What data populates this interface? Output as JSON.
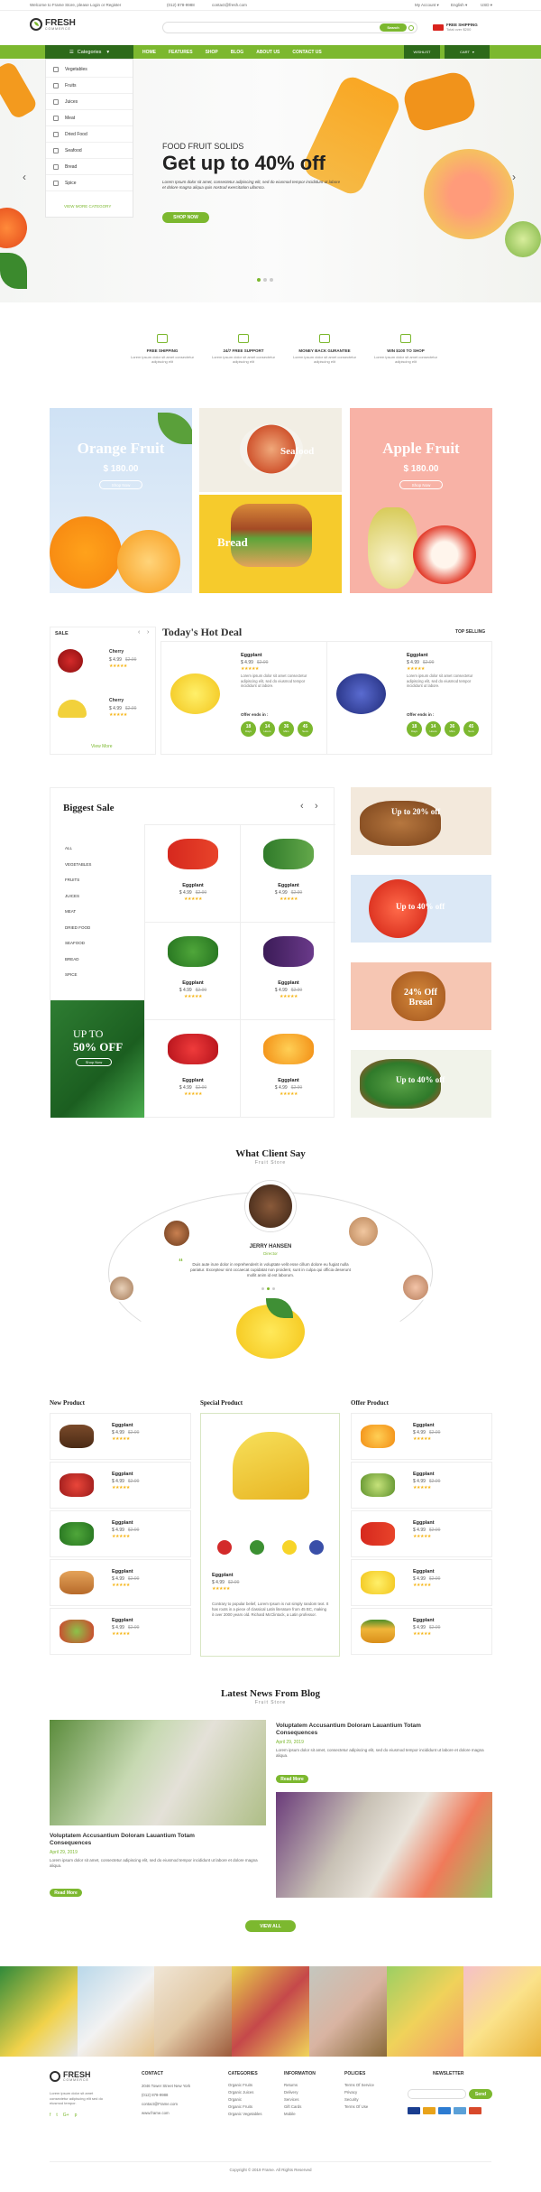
{
  "topbar": {
    "welcome": "Welcome to Frame Store, please Login or Register",
    "phone": "(012) 878-9988",
    "email": "contact@fresh.com",
    "account": "My Account ▾",
    "language": "English ▾",
    "currency": "USD ▾"
  },
  "header": {
    "logo_main": "FRESH",
    "logo_sub": "COMMERCE",
    "search_placeholder": "",
    "search_button": "Search",
    "shipping_title": "FREE SHIPPING",
    "shipping_sub": "Total over $200"
  },
  "nav": {
    "categories_label": "Categories",
    "items": [
      "HOME",
      "FEATURES",
      "SHOP",
      "BLOG",
      "ABOUT US",
      "CONTACT US"
    ],
    "wishlist": "WISHLIST",
    "cart": "CART"
  },
  "categories": [
    "Vegetables",
    "Fruits",
    "Juices",
    "Meat",
    "Dried Food",
    "Seafood",
    "Bread",
    "Spice"
  ],
  "categories_more": "VIEW MORE CATEGORY",
  "hero": {
    "kicker": "FOOD FRUIT SOLIDS",
    "title": "Get up to 40% off",
    "desc": "Lorem Ipsum dolor sit amet, consectetur adipiscing elit, sed do eiusmod tempor incididunt ut labore et dolore magna aliqua quis nostrud exercitation ullamco.",
    "button": "SHOP NOW"
  },
  "features": [
    {
      "title": "FREE SHIPPING",
      "desc": "Lorem ipsum dolor sit amet consectetur adipiscing elit"
    },
    {
      "title": "24/7 FREE SUPPORT",
      "desc": "Lorem ipsum dolor sit amet consectetur adipiscing elit"
    },
    {
      "title": "MONEY BACK GURANTEE",
      "desc": "Lorem ipsum dolor sit amet consectetur adipiscing elit"
    },
    {
      "title": "WIN $100 TO SHOP",
      "desc": "Lorem ipsum dolor sit amet consectetur adipiscing elit"
    }
  ],
  "banners": {
    "orange_title": "Orange Fruit",
    "orange_price": "$ 180.00",
    "orange_btn": "Shop Now",
    "seafood": "Seafood",
    "bread": "Bread",
    "apple_title": "Apple Fruit",
    "apple_price": "$ 180.00",
    "apple_btn": "Shop Now"
  },
  "sale": {
    "label": "SALE",
    "items": [
      {
        "name": "Cherry",
        "price": "$ 4.99",
        "old": "$2.99"
      },
      {
        "name": "Cherry",
        "price": "$ 4.99",
        "old": "$2.99"
      }
    ],
    "view_more": "View More"
  },
  "hot_deal": {
    "title": "Today's Hot Deal",
    "top_selling": "TOP SELLING",
    "items": [
      {
        "name": "Eggplant",
        "price": "$ 4.99",
        "old": "$2.99",
        "desc": "Lorem ipsum dolor sit amet consectetur adipiscing elit, sed do eiusmod tempor incididunt ut labore.",
        "offer": "Offer ends in :",
        "timer": [
          "18",
          "14",
          "36",
          "45"
        ],
        "timer_labels": [
          "Days",
          "Hours",
          "Mins",
          "Secs"
        ]
      },
      {
        "name": "Eggplant",
        "price": "$ 4.99",
        "old": "$2.99",
        "desc": "Lorem ipsum dolor sit amet consectetur adipiscing elit, sed do eiusmod tempor incididunt ut labore.",
        "offer": "Offer ends in :",
        "timer": [
          "18",
          "14",
          "36",
          "45"
        ],
        "timer_labels": [
          "Days",
          "Hours",
          "Mins",
          "Secs"
        ]
      }
    ]
  },
  "biggest_sale": {
    "title": "Biggest Sale",
    "menu": [
      "ALL",
      "VEGETABLES",
      "FRUITS",
      "JUICES",
      "MEAT",
      "DRIED FOOD",
      "SEAFOOD",
      "BREAD",
      "SPICE"
    ],
    "promo_line1": "UP TO",
    "promo_line2": "50% OFF",
    "promo_btn": "Shop Now",
    "products": [
      {
        "name": "Eggplant",
        "price": "$ 4.99",
        "old": "$2.99"
      },
      {
        "name": "Eggplant",
        "price": "$ 4.99",
        "old": "$2.99"
      },
      {
        "name": "Eggplant",
        "price": "$ 4.99",
        "old": "$2.99"
      },
      {
        "name": "Eggplant",
        "price": "$ 4.99",
        "old": "$2.99"
      },
      {
        "name": "Eggplant",
        "price": "$ 4.99",
        "old": "$2.99"
      },
      {
        "name": "Eggplant",
        "price": "$ 4.99",
        "old": "$2.99"
      }
    ]
  },
  "side_banners": [
    "Up to 20% off",
    "Up to 40% off",
    "24% Off Bread",
    "Up to 40% off"
  ],
  "testimonial": {
    "title": "What Client Say",
    "subtitle": "Fruit Store",
    "name": "JERRY HANSEN",
    "role": "Director",
    "quote": "Duis aute irure dolor in reprehenderit in voluptate velit esse cillum dolore eu fugiat nulla pariatur. Excepteur sint occaecat cupidatat non proident, sunt in culpa qui officia deserunt mollit anim id est laborum."
  },
  "product_cols": {
    "new": "New Product",
    "special": "Special Product",
    "offer": "Offer Product",
    "item": {
      "name": "Eggplant",
      "price": "$ 4.99",
      "old": "$2.99"
    },
    "special_desc": "Contrary to popular belief, Lorem Ipsum is not simply random text. It has roots in a piece of classical Latin literature from 45 BC, making it over 2000 years old. Richard McClintock, a Latin professor."
  },
  "blog": {
    "title": "Latest News From Blog",
    "subtitle": "Fruit Store",
    "posts": [
      {
        "title": "Voluptatem Accusantium Doloram Lauantium Totam Consequences",
        "date": "April 29, 2019",
        "desc": "Lorem ipsum dolor sit amet, consectetur adipiscing elit, sed do eiusmod tempor incididunt ut labore et dolore magna aliqua.",
        "btn": "Read More"
      },
      {
        "title": "Voluptatem Accusantium Doloram Lauantium Totam Consequences",
        "date": "April 29, 2019",
        "desc": "Lorem ipsum dolor sit amet, consectetur adipiscing elit, sed do eiusmod tempor incididunt ut labore et dolore magna aliqua.",
        "btn": "Read More"
      }
    ],
    "view_all": "VIEW ALL"
  },
  "footer": {
    "logo_main": "FRESH",
    "logo_sub": "COMMERCE",
    "about": "Lorem ipsum dolor sit amet consectetur adipiscing elit sed do eiusmod tempor.",
    "contact_title": "CONTACT",
    "contact": [
      "2046 Tower Street New York",
      "(012) 878-9988",
      "contact@Frame.com",
      "www.frame.com"
    ],
    "categories_title": "CATEGORIES",
    "categories": [
      "Organic Fruits",
      "Organic Juices",
      "Organic",
      "Organic Fruits",
      "Organic Vegetables"
    ],
    "info_title": "INFORMATION",
    "info": [
      "Returns",
      "Delivery",
      "Services",
      "Gift Cards",
      "Mobile"
    ],
    "policies_title": "POLICIES",
    "policies": [
      "Terms Of Service",
      "Privacy",
      "Security",
      "Terms Of Use"
    ],
    "newsletter_title": "NEWSLETTER",
    "newsletter_btn": "Send",
    "copyright": "Copyright © 2019 Frame. All Rights Reserved"
  },
  "colors": {
    "brand": "#7cb82f",
    "dark": "#2d6a1a"
  }
}
